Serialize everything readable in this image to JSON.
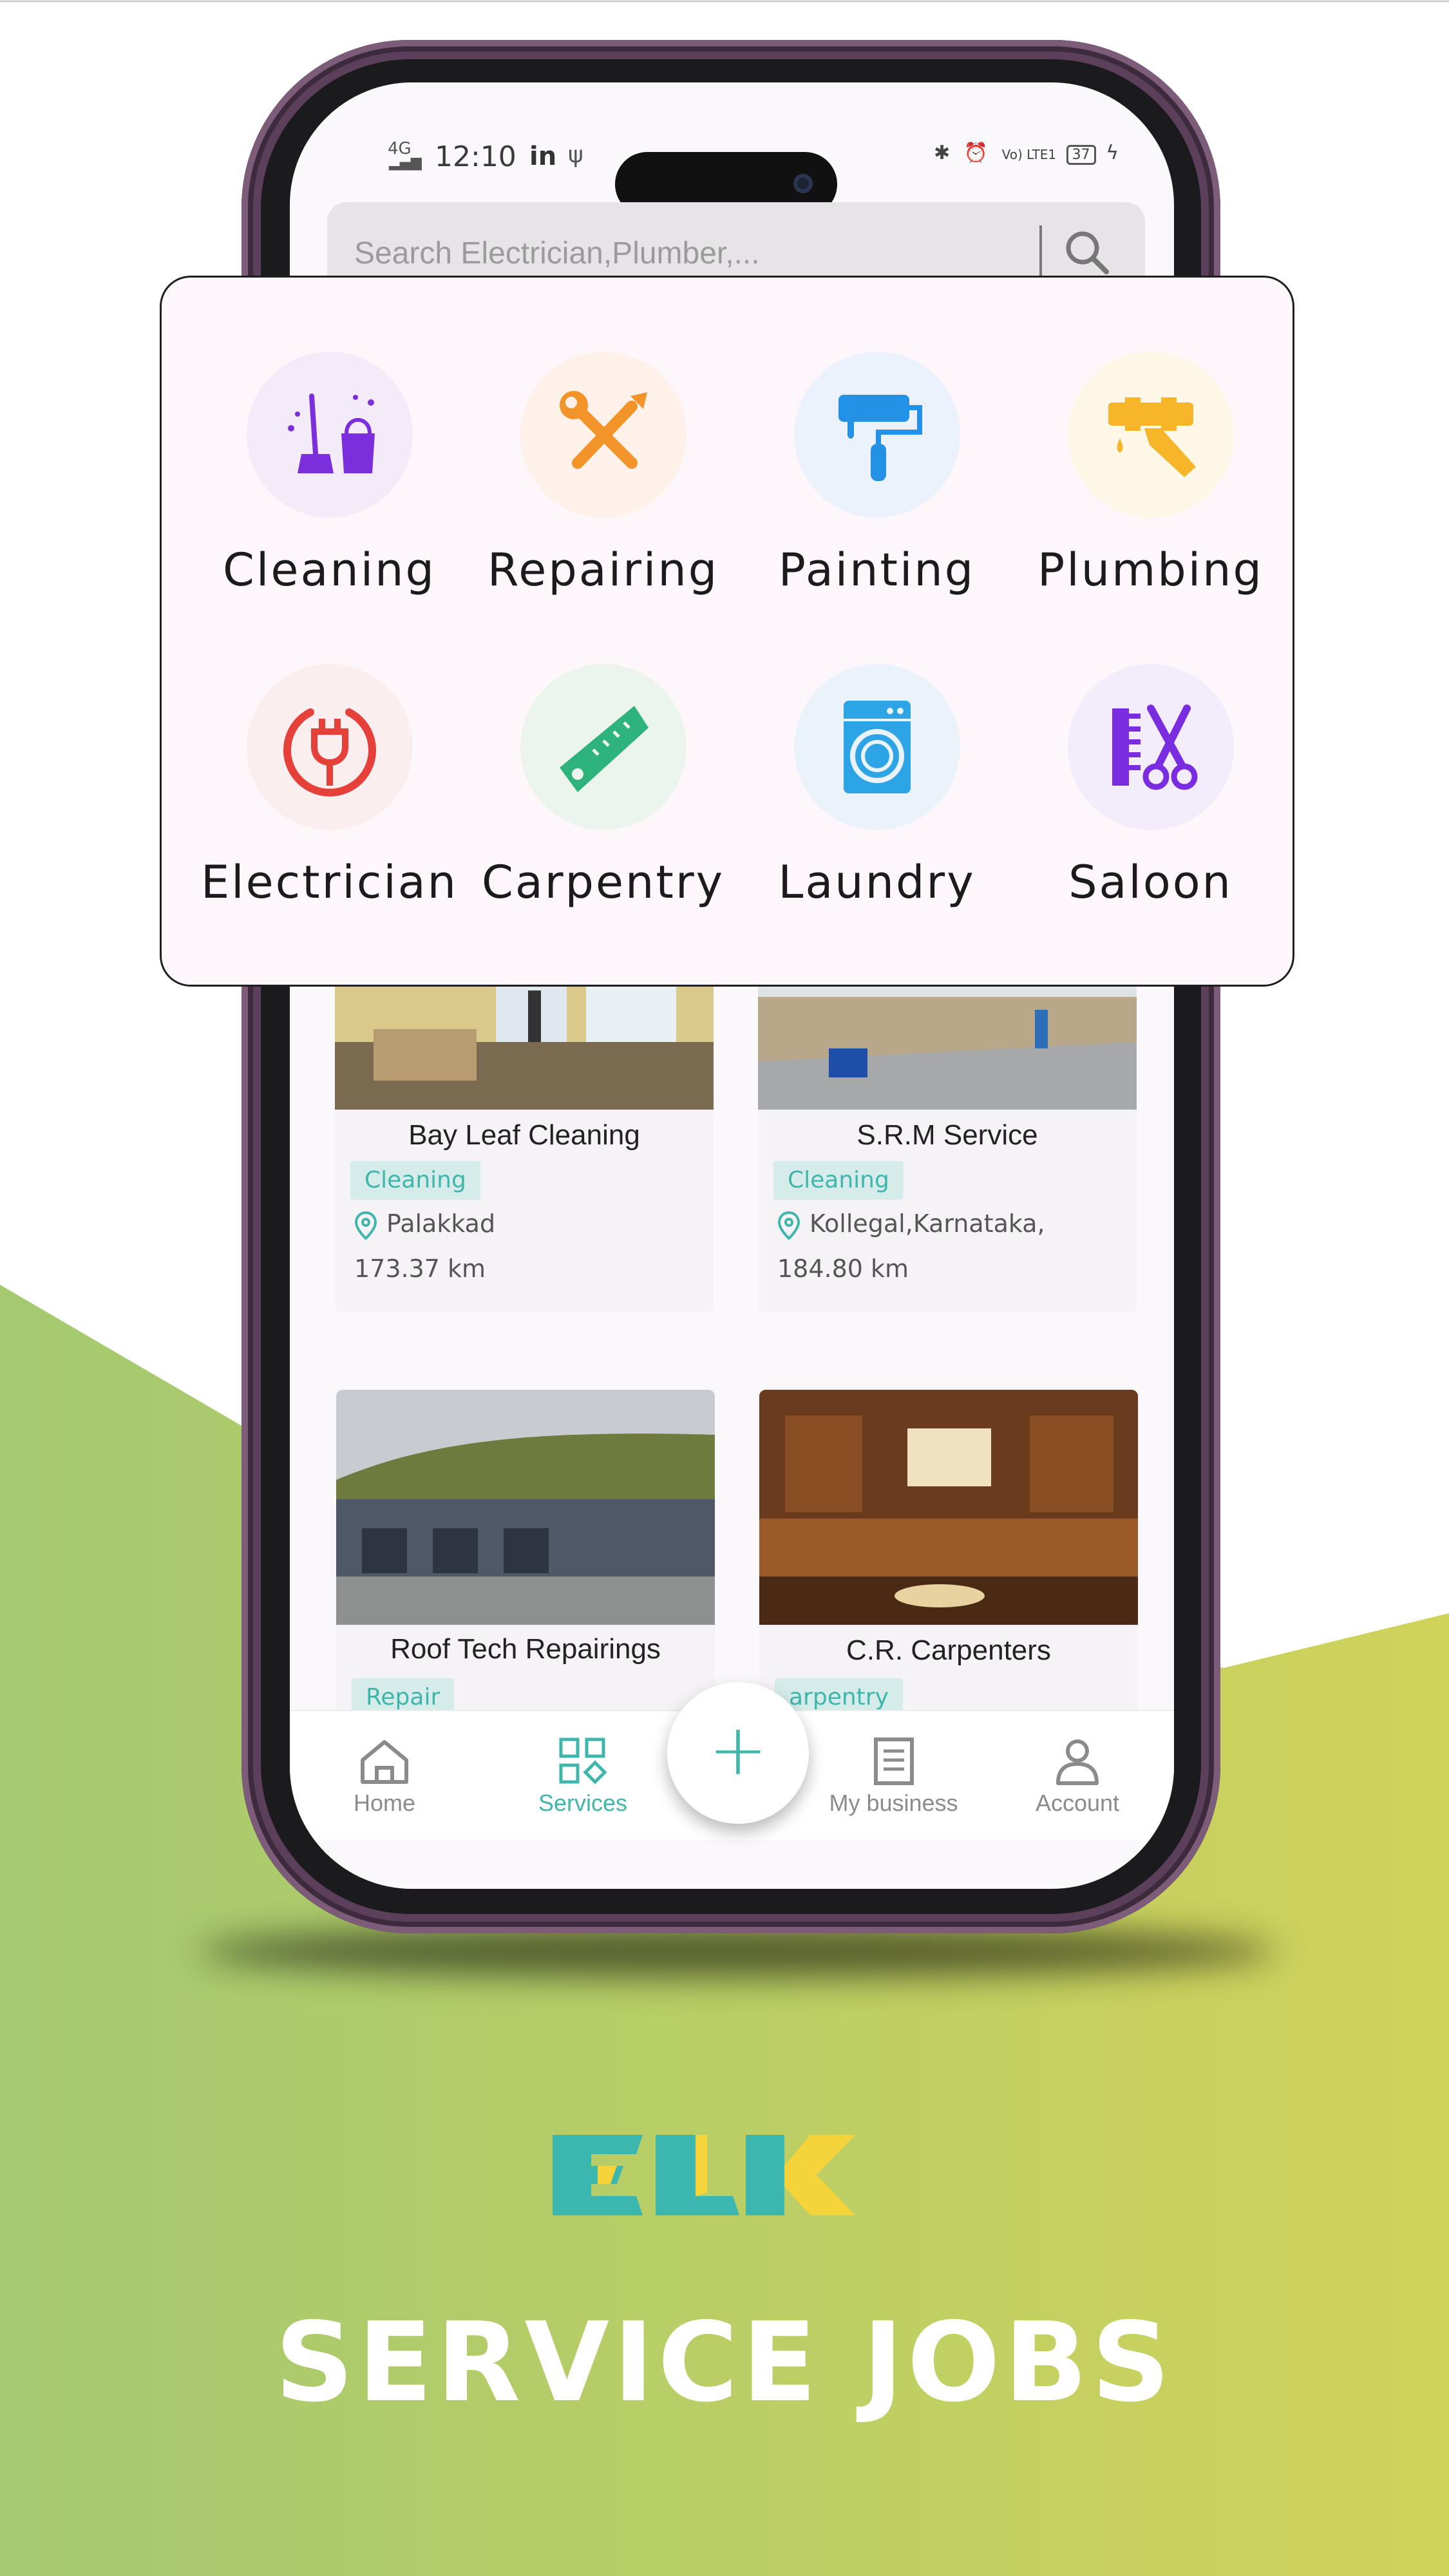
{
  "status_bar": {
    "time": "12:10",
    "network": "4G",
    "apps": "in",
    "indicators": "Vo) LTE1",
    "battery": "37"
  },
  "search": {
    "placeholder": "Search Electrician,Plumber,..."
  },
  "categories": [
    {
      "label": "Cleaning",
      "icon": "cleaning-icon",
      "bg": "#f3ecf8",
      "color": "#7b2fdc"
    },
    {
      "label": "Repairing",
      "icon": "repair-tools-icon",
      "bg": "#fdf1ea",
      "color": "#f2942a"
    },
    {
      "label": "Painting",
      "icon": "paint-roller-icon",
      "bg": "#ebf2fb",
      "color": "#2391e6"
    },
    {
      "label": "Plumbing",
      "icon": "pipe-wrench-icon",
      "bg": "#fdf7e8",
      "color": "#f7b62a"
    },
    {
      "label": "Electrician",
      "icon": "plug-icon",
      "bg": "#fbeeee",
      "color": "#e6403a"
    },
    {
      "label": "Carpentry",
      "icon": "saw-icon",
      "bg": "#ecf4ee",
      "color": "#2fb37d"
    },
    {
      "label": "Laundry",
      "icon": "washing-machine-icon",
      "bg": "#eaf2fa",
      "color": "#2da4e6"
    },
    {
      "label": "Saloon",
      "icon": "scissors-comb-icon",
      "bg": "#f3ecfb",
      "color": "#7a2de0"
    }
  ],
  "listings": [
    {
      "name": "Bay Leaf Cleaning",
      "tag": "Cleaning",
      "location": "Palakkad",
      "distance": "173.37 km"
    },
    {
      "name": "S.R.M Service",
      "tag": "Cleaning",
      "location": "Kollegal,Karnataka,",
      "distance": "184.80 km"
    },
    {
      "name": "Roof Tech Repairings",
      "tag": "Repair",
      "location": "",
      "distance": ""
    },
    {
      "name": "C.R. Carpenters",
      "tag": "arpentry",
      "location": "",
      "distance": ""
    }
  ],
  "bottom_nav": {
    "home": "Home",
    "services": "Services",
    "fab": "+",
    "my_business": "My business",
    "account": "Account"
  },
  "branding": {
    "logo_icon": "elk-logo",
    "tagline": "SERVICE JOBS"
  },
  "colors": {
    "accent": "#3fb5ac",
    "bg_green": "#a6ca72",
    "bg_yellow": "#d0d35a",
    "logo_teal": "#3cb7b0",
    "logo_yellow": "#f5d33a"
  }
}
